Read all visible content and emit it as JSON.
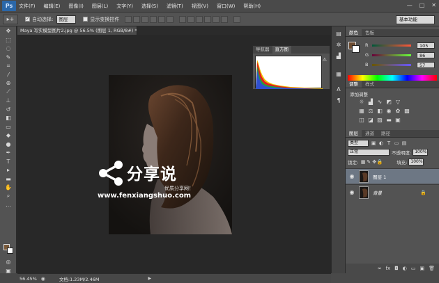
{
  "app": {
    "logo": "Ps",
    "menu": [
      "文件(F)",
      "编辑(E)",
      "图像(I)",
      "图层(L)",
      "文字(Y)",
      "选择(S)",
      "滤镜(T)",
      "视图(V)",
      "窗口(W)",
      "帮助(H)"
    ],
    "window_controls": [
      "—",
      "□",
      "✕"
    ]
  },
  "options_bar": {
    "auto_select_label": "自动选择:",
    "auto_select_value": "图层",
    "show_transform_label": "显示变换控件",
    "workspace": "基本功能"
  },
  "document": {
    "tab_title": "Maya 写实模型图片2.jpg @ 56.5% (图层 1, RGB/8#) *",
    "tab_close": "×"
  },
  "histogram_panel": {
    "tabs": [
      "导航器",
      "直方图"
    ],
    "active_tab": 1,
    "warning_icon": "⚠"
  },
  "color_panel": {
    "tabs": [
      "颜色",
      "色板"
    ],
    "r_label": "R",
    "r_value": "105",
    "g_label": "G",
    "g_value": "86",
    "b_label": "B",
    "b_value": "57",
    "fg_hex": "#695739"
  },
  "adjust_panel": {
    "tabs": [
      "调整",
      "样式"
    ],
    "title": "添加调整"
  },
  "layers_panel": {
    "tabs": [
      "图层",
      "通道",
      "路径"
    ],
    "filter_kind": "类型",
    "blend_mode": "正常",
    "opacity_label": "不透明度:",
    "opacity_value": "100%",
    "lock_label": "锁定:",
    "fill_label": "填充:",
    "fill_value": "100%",
    "layers": [
      {
        "name": "图层 1",
        "selected": true
      },
      {
        "name": "背景",
        "selected": false,
        "locked": true
      }
    ]
  },
  "status": {
    "zoom": "56.45%",
    "doc_info": "文档:1.23M/2.46M"
  },
  "watermark": {
    "title": "分享说",
    "subtitle": "优质分享网！",
    "url": "www.fenxiangshuo.com"
  }
}
